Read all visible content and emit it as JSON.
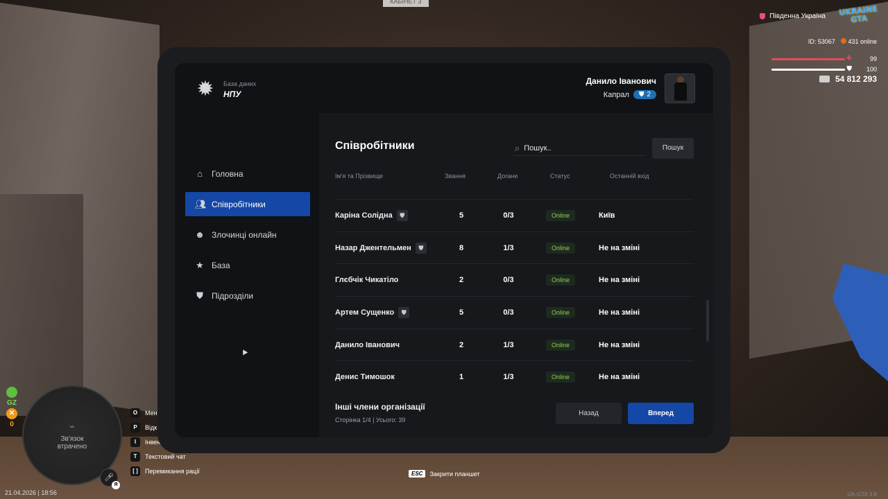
{
  "background": {
    "door_sign": "КАБІНЕТ 3"
  },
  "hud": {
    "region": "Південна Україна",
    "logo_text": "UKRAINE GTA",
    "player_id": "ID: 53067",
    "online": "431 online",
    "health": "99",
    "armor": "100",
    "money": "54 812 293",
    "status_gz": "GZ",
    "status_zero": "0",
    "minimap_text": "Зв'язок втрачено",
    "lang": "Я",
    "datetime": "21.04.2026 | 18:56",
    "hotkeys": [
      {
        "key": "O",
        "label": "Мен"
      },
      {
        "key": "P",
        "label": "Відк"
      },
      {
        "key": "I",
        "label": "Інвент"
      },
      {
        "key": "T",
        "label": "Текстовий чат"
      },
      {
        "key": "[ ]",
        "label": "Перемикання рації"
      }
    ],
    "esc_key": "ESC",
    "esc_label": "Закрити планшет",
    "version": "UA-GTA 3.8"
  },
  "tablet": {
    "brand_sub": "База даних",
    "brand_title": "НПУ",
    "user_name": "Данило Іванович",
    "user_rank": "Капрал",
    "user_rank_level": "2",
    "nav": [
      {
        "label": "Головна",
        "icon": "home-icon"
      },
      {
        "label": "Співробітники",
        "icon": "users-icon"
      },
      {
        "label": "Злочинці онлайн",
        "icon": "mask-icon"
      },
      {
        "label": "База",
        "icon": "star-icon"
      },
      {
        "label": "Підрозділи",
        "icon": "shield-icon"
      }
    ],
    "page_title": "Співробітники",
    "search_placeholder": "Пошук..",
    "search_button": "Пошук",
    "columns": [
      "Ім'я та Прізвище",
      "Звання",
      "Догани",
      "Статус",
      "Останній вхід"
    ],
    "rows": [
      {
        "name": "Каріна Солідна",
        "badge": true,
        "rank": "5",
        "reprimands": "0/3",
        "status": "Online",
        "last": "Київ"
      },
      {
        "name": "Назар Джентельмен",
        "badge": true,
        "rank": "8",
        "reprimands": "1/3",
        "status": "Online",
        "last": "Не на зміні"
      },
      {
        "name": "Глєбчік Чикатіло",
        "badge": false,
        "rank": "2",
        "reprimands": "0/3",
        "status": "Online",
        "last": "Не на зміні"
      },
      {
        "name": "Артем Сущенко",
        "badge": true,
        "rank": "5",
        "reprimands": "0/3",
        "status": "Online",
        "last": "Не на зміні"
      },
      {
        "name": "Данило Іванович",
        "badge": false,
        "rank": "2",
        "reprimands": "1/3",
        "status": "Online",
        "last": "Не на зміні"
      },
      {
        "name": "Денис Тимошок",
        "badge": false,
        "rank": "1",
        "reprimands": "1/3",
        "status": "Online",
        "last": "Не на зміні"
      }
    ],
    "footer_title": "Інші члени організації",
    "footer_sub": "Сторінка 1/4 | Усього: 39",
    "btn_back": "Назад",
    "btn_next": "Вперед"
  },
  "colors": {
    "accent": "#1447a6",
    "online": "#8fd14f",
    "health": "#e94a5c"
  }
}
